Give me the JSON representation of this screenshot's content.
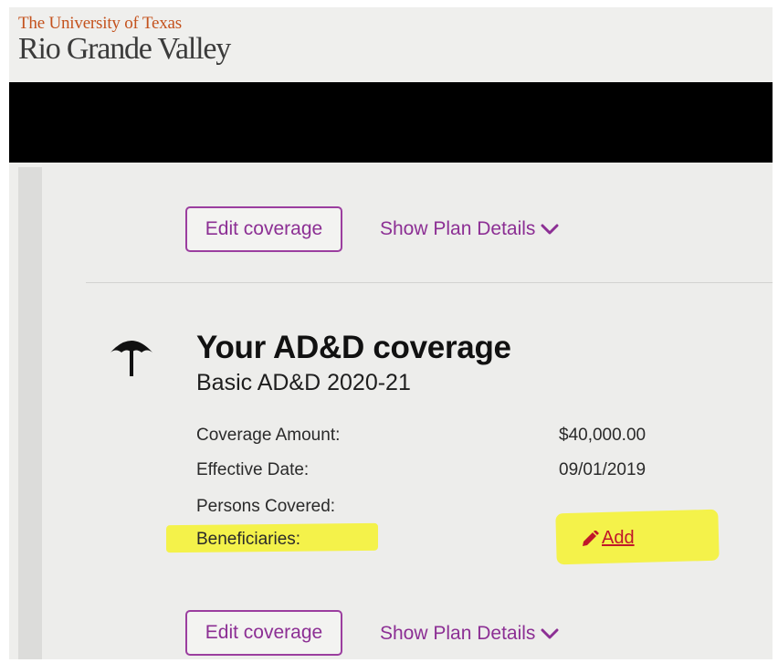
{
  "header": {
    "logo_line1": "The University of Texas",
    "logo_line2": "Rio Grande Valley"
  },
  "top_actions": {
    "edit_label": "Edit coverage",
    "details_label": "Show Plan Details"
  },
  "coverage": {
    "title": "Your AD&D coverage",
    "plan_name": "Basic AD&D 2020-21",
    "rows": [
      {
        "label": "Coverage Amount:",
        "value": "$40,000.00"
      },
      {
        "label": "Effective Date:",
        "value": "09/01/2019"
      },
      {
        "label": "Persons Covered:",
        "value": ""
      },
      {
        "label": "Beneficiaries:",
        "value": ""
      }
    ],
    "add_label": "Add"
  },
  "bottom_actions": {
    "edit_label": "Edit coverage",
    "details_label": "Show Plan Details"
  },
  "colors": {
    "accent": "#8c2f94",
    "logo_orange": "#c4521d",
    "add_link": "#c0162a",
    "highlight": "#f4f24a"
  },
  "icons": {
    "coverage": "umbrella-icon",
    "details_toggle": "chevron-down-icon",
    "add": "pencil-icon"
  }
}
